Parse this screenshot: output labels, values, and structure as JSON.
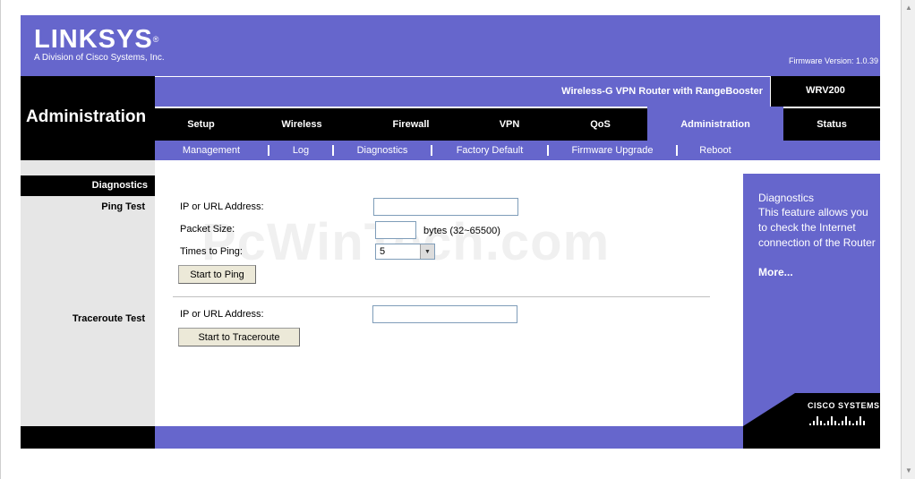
{
  "header": {
    "logo_text": "LINKSYS",
    "logo_mark": "®",
    "logo_subtitle": "A Division of Cisco Systems, Inc.",
    "firmware_label": "Firmware Version: 1.0.39"
  },
  "section": {
    "title": "Administration"
  },
  "product": {
    "name": "Wireless-G VPN Router with RangeBooster",
    "model": "WRV200"
  },
  "tabs": [
    {
      "label": "Setup",
      "active": false
    },
    {
      "label": "Wireless",
      "active": false
    },
    {
      "label": "Firewall",
      "active": false
    },
    {
      "label": "VPN",
      "active": false
    },
    {
      "label": "QoS",
      "active": false
    },
    {
      "label": "Administration",
      "active": true
    },
    {
      "label": "Status",
      "active": false
    }
  ],
  "subtabs": [
    {
      "label": "Management"
    },
    {
      "label": "Log"
    },
    {
      "label": "Diagnostics"
    },
    {
      "label": "Factory Default"
    },
    {
      "label": "Firmware Upgrade"
    },
    {
      "label": "Reboot"
    }
  ],
  "left": {
    "current": "Diagnostics",
    "ping_label": "Ping Test",
    "traceroute_label": "Traceroute Test"
  },
  "ping": {
    "address_label": "IP or URL Address:",
    "address_value": "",
    "packet_label": "Packet Size:",
    "packet_value": "",
    "packet_hint": "bytes (32~65500)",
    "times_label": "Times to Ping:",
    "times_value": "5",
    "button": "Start to Ping"
  },
  "traceroute": {
    "address_label": "IP or URL Address:",
    "address_value": "",
    "button": "Start to Traceroute"
  },
  "help": {
    "title": "Diagnostics",
    "text": "This feature allows you to check the Internet connection of the Router",
    "more": "More..."
  },
  "watermark": "PcWinTech.com",
  "cisco": {
    "text": "CISCO SYSTEMS"
  },
  "colors": {
    "brand_purple": "#6666cc",
    "black": "#000000",
    "gray": "#e6e6e6"
  }
}
